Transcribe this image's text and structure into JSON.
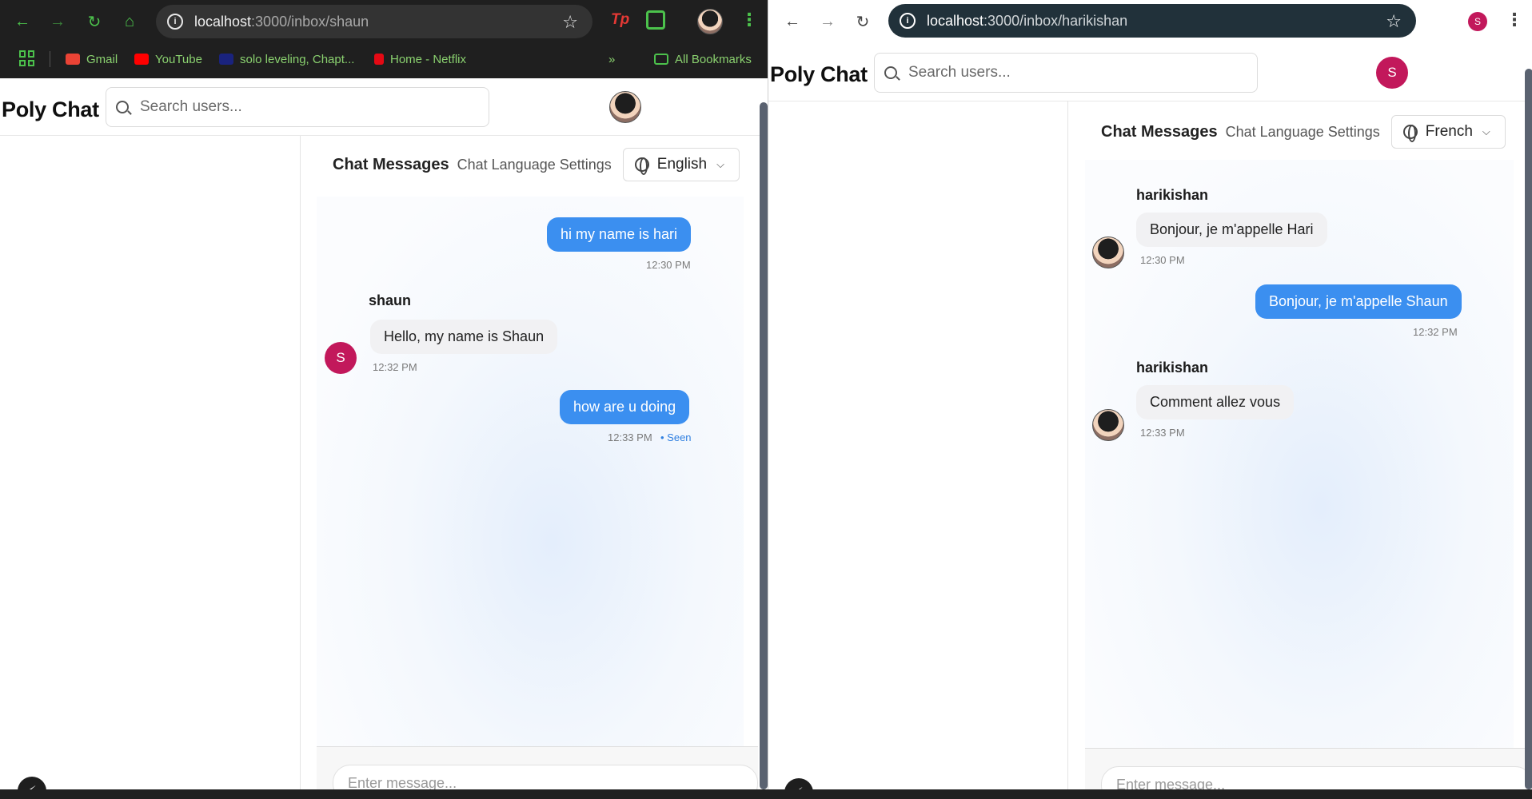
{
  "left": {
    "browser": {
      "url_host": "localhost",
      "url_path": ":3000/inbox/shaun",
      "ext_tp": "Tp",
      "bookmarks": [
        {
          "label": "Gmail",
          "color": "#ea4335"
        },
        {
          "label": "YouTube",
          "color": "#ff0000"
        },
        {
          "label": "solo leveling, Chapt...",
          "color": "#1a237e"
        },
        {
          "label": "Home - Netflix",
          "color": "#e50914"
        }
      ],
      "more_chevron": "»",
      "all_bookmarks": "All Bookmarks"
    },
    "app": {
      "brand": "Poly Chat",
      "search_placeholder": "Search users...",
      "chat_title": "Chat Messages",
      "lang_settings_label": "Chat Language Settings",
      "language": "English",
      "composer_placeholder": "Enter message...",
      "messages": [
        {
          "dir": "out",
          "text": "hi my name is hari",
          "time": "12:30 PM"
        },
        {
          "dir": "in",
          "sender": "shaun",
          "avatar_letter": "S",
          "text": "Hello, my name is Shaun",
          "time": "12:32 PM"
        },
        {
          "dir": "out",
          "text": "how are u doing",
          "time": "12:33 PM",
          "status": "• Seen"
        }
      ]
    }
  },
  "right": {
    "browser": {
      "url_host": "localhost",
      "url_path": ":3000/inbox/harikishan",
      "profile_letter": "S"
    },
    "app": {
      "brand": "Poly Chat",
      "search_placeholder": "Search users...",
      "profile_letter": "S",
      "chat_title": "Chat Messages",
      "lang_settings_label": "Chat Language Settings",
      "language": "French",
      "composer_placeholder": "Enter message...",
      "messages": [
        {
          "dir": "in",
          "sender": "harikishan",
          "text": "Bonjour, je m'appelle Hari",
          "time": "12:30 PM"
        },
        {
          "dir": "out",
          "text": "Bonjour, je m'appelle Shaun",
          "time": "12:32 PM"
        },
        {
          "dir": "in",
          "sender": "harikishan",
          "text": "Comment allez vous",
          "time": "12:33 PM"
        }
      ]
    }
  },
  "colors": {
    "accent_bubble": "#3b8ff0",
    "avatar_s": "#c2185b",
    "dark_chrome": "#1f1f1f",
    "chrome_icons_green": "#4cc24c"
  }
}
